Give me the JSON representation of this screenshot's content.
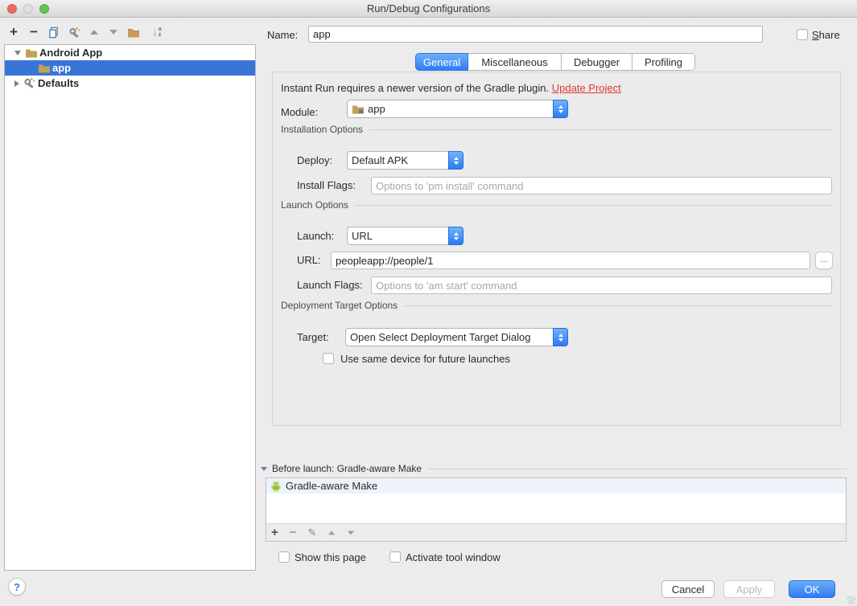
{
  "window": {
    "title": "Run/Debug Configurations"
  },
  "icons": {
    "plus": "+",
    "minus": "−",
    "pencil": "✎",
    "help": "?",
    "sort_arrow": "↓",
    "sort_a": "a",
    "sort_z": "z",
    "ellipsis": "..."
  },
  "tree": {
    "items": [
      {
        "label": "Android App",
        "expanded": true,
        "selected": false
      },
      {
        "label": "app",
        "selected": true
      },
      {
        "label": "Defaults",
        "expanded": false,
        "selected": false
      }
    ]
  },
  "header": {
    "name_label": "Name:",
    "name_value": "app",
    "share_underline": "S",
    "share_rest": "hare",
    "share_checked": false
  },
  "tabs": [
    {
      "label": "General",
      "selected": true
    },
    {
      "label": "Miscellaneous",
      "selected": false
    },
    {
      "label": "Debugger",
      "selected": false
    },
    {
      "label": "Profiling",
      "selected": false
    }
  ],
  "general": {
    "warning_text": "Instant Run requires a newer version of the Gradle plugin.",
    "warning_link": "Update Project",
    "module_label": "Module:",
    "module_value": "app",
    "installation_section": "Installation Options",
    "deploy_label": "Deploy:",
    "deploy_value": "Default APK",
    "install_flags_label": "Install Flags:",
    "install_flags_placeholder": "Options to 'pm install' command",
    "launch_section": "Launch Options",
    "launch_label": "Launch:",
    "launch_value": "URL",
    "url_label": "URL:",
    "url_value": "peopleapp://people/1",
    "launch_flags_label": "Launch Flags:",
    "launch_flags_placeholder": "Options to 'am start' command",
    "deployment_section": "Deployment Target Options",
    "target_label": "Target:",
    "target_value": "Open Select Deployment Target Dialog",
    "use_same_device_label": "Use same device for future launches",
    "use_same_device_checked": false
  },
  "before_launch": {
    "title": "Before launch: Gradle-aware Make",
    "items": [
      {
        "label": "Gradle-aware Make"
      }
    ]
  },
  "footer": {
    "show_this_page": "Show this page",
    "activate_tool_window": "Activate tool window"
  },
  "buttons": {
    "cancel": "Cancel",
    "apply": "Apply",
    "ok": "OK"
  },
  "colors": {
    "selection_blue": "#3974d8",
    "accent_blue": "#2f7cf6",
    "link_red": "#e3382c",
    "android_green": "#97c024",
    "folder_tan": "#c89a5b"
  }
}
